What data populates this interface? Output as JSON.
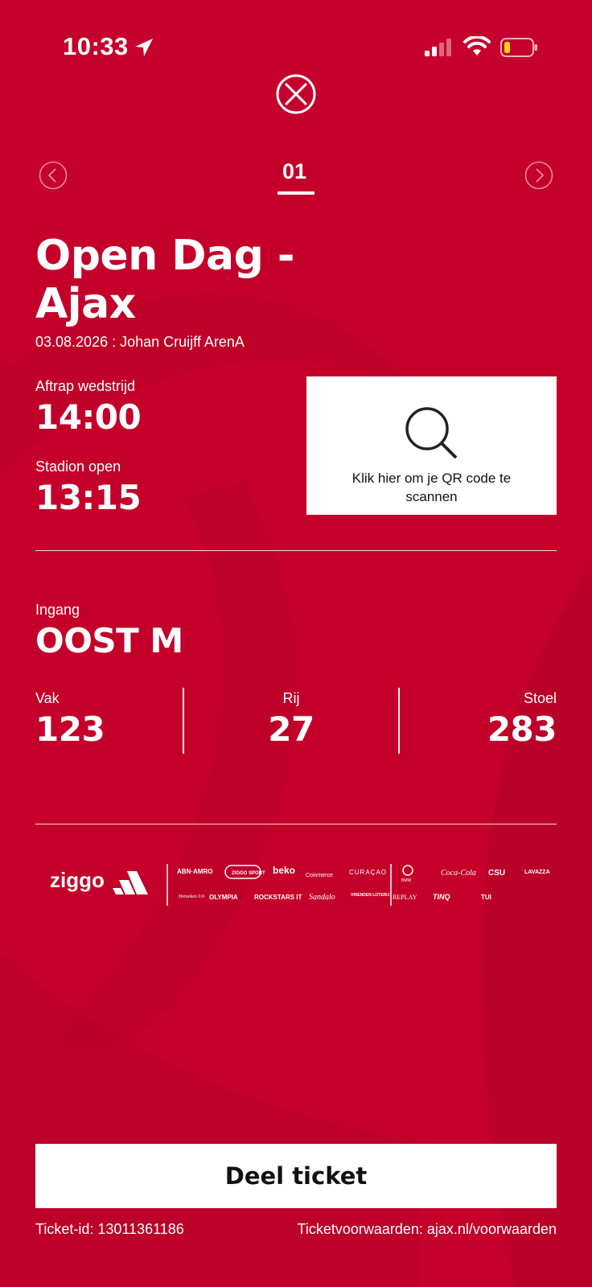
{
  "status_bar": {
    "time": "10:33"
  },
  "ticket_nav": {
    "ticket_number": "01"
  },
  "event": {
    "title": "Open Dag - Ajax",
    "date_venue": "03.08.2026 : Johan Cruijff ArenA"
  },
  "times": {
    "kickoff_label": "Aftrap wedstrijd",
    "kickoff_value": "14:00",
    "stadium_label": "Stadion open",
    "stadium_value": "13:15"
  },
  "qr": {
    "text": "Klik hier om je QR code te scannen"
  },
  "seat": {
    "entrance_label": "Ingang",
    "entrance_value": "OOST M",
    "section_label": "Vak",
    "section_value": "123",
    "row_label": "Rij",
    "row_value": "27",
    "seat_label": "Stoel",
    "seat_value": "283"
  },
  "sponsors": {
    "main": [
      "ziggo",
      "adidas-logo"
    ],
    "row1": [
      "ABN·AMRO",
      "ZIGGO SPORT",
      "beko",
      "Coinmerce",
      "CURAÇAO",
      "BMW",
      "Coca-Cola",
      "CSU",
      "LAVAZZA"
    ],
    "row2": [
      "Heineken 0.0",
      "OLYMPIA",
      "ROCKSTARS IT",
      "Sandalo",
      "VRIENDEN LOTERIJ",
      "REPLAY",
      "TINQ",
      "TUI"
    ]
  },
  "actions": {
    "share_label": "Deel ticket"
  },
  "footer": {
    "ticket_id": "Ticket-id: 13011361186",
    "terms": "Ticketvoorwaarden: ajax.nl/voorwaarden"
  },
  "colors": {
    "background": "#c4002a",
    "card": "#ffffff"
  }
}
